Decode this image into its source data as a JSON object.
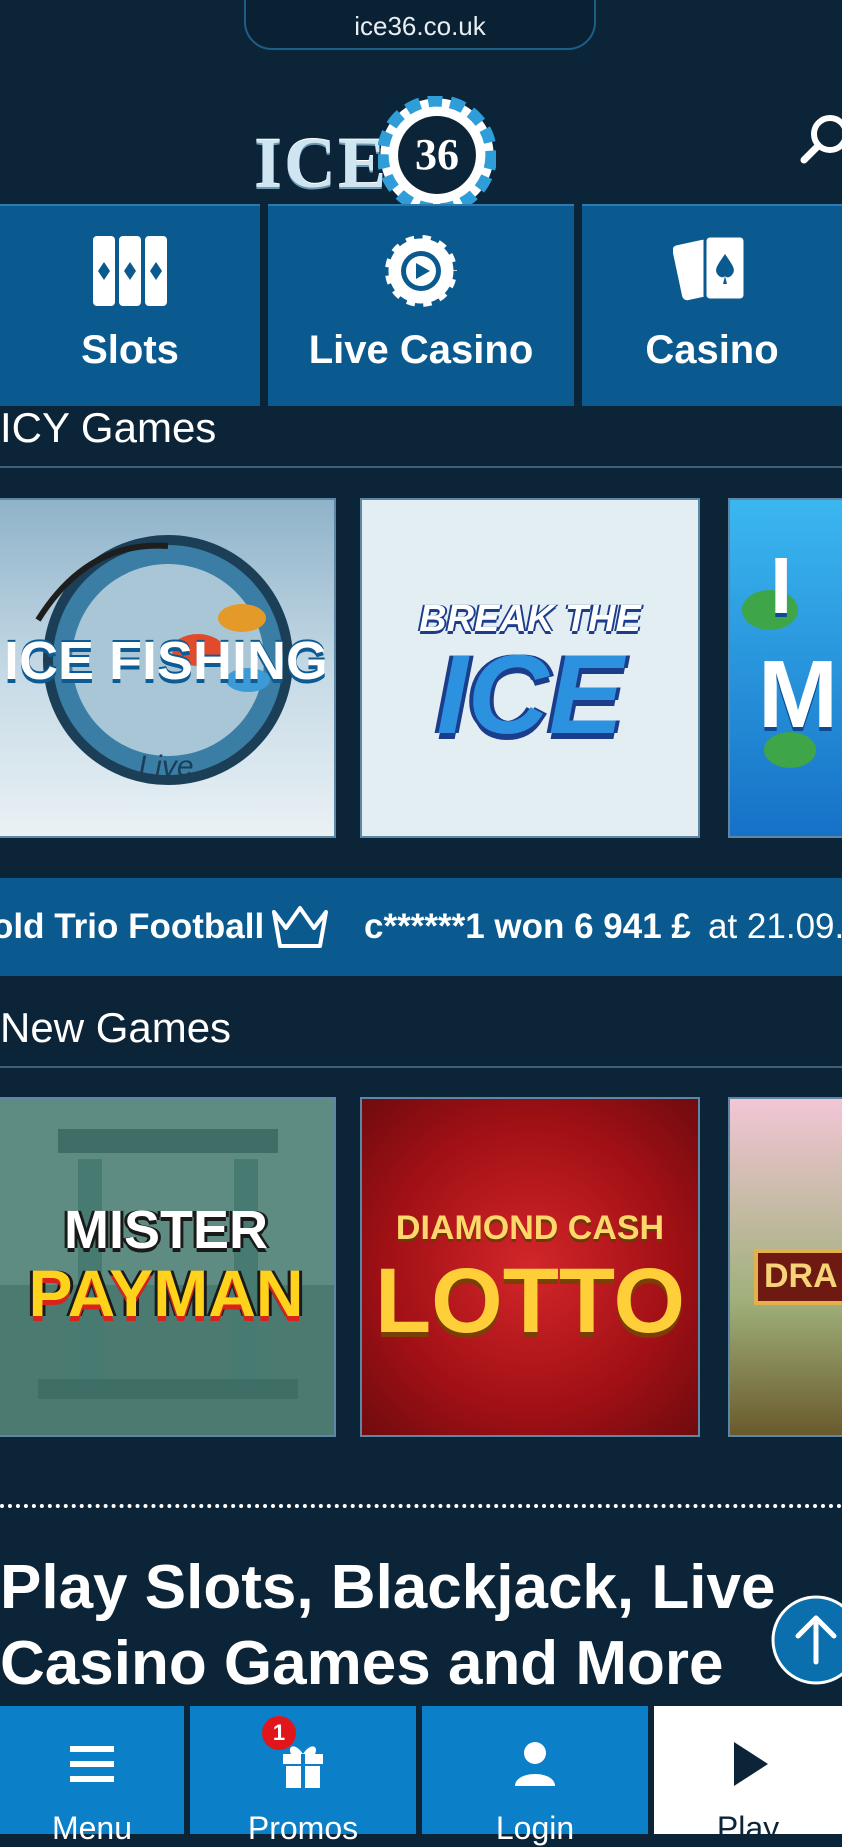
{
  "browser": {
    "url": "ice36.co.uk"
  },
  "header": {
    "logo_text": "ICE",
    "logo_chip_number": "36"
  },
  "categories": [
    {
      "label": "Slots"
    },
    {
      "label": "Live Casino"
    },
    {
      "label": "Casino"
    }
  ],
  "sections": [
    {
      "title": "ICY Games",
      "games": [
        {
          "title": "ICE FISHING",
          "subtitle": "Live"
        },
        {
          "title": "ICE",
          "subtitle": "BREAK THE"
        },
        {
          "title": "M",
          "subtitle": "I"
        }
      ]
    },
    {
      "title": "New Games",
      "games": [
        {
          "title": "PAYMAN",
          "subtitle": "MISTER"
        },
        {
          "title": "LOTTO",
          "subtitle": "DIAMOND CASH"
        },
        {
          "title": "DRA",
          "subtitle": ""
        }
      ]
    }
  ],
  "ticker": {
    "game_fragment": "old Trio Football",
    "winner": "c******1 won 6 941 £",
    "suffix": " at 21.09."
  },
  "headline": "Play Slots, Blackjack, Live Casino Games and More",
  "bottom_nav": [
    {
      "label": "Menu",
      "icon": "menu-icon"
    },
    {
      "label": "Promos",
      "icon": "gift-icon",
      "badge": "1"
    },
    {
      "label": "Login",
      "icon": "user-icon"
    },
    {
      "label": "Play",
      "icon": "play-icon"
    }
  ],
  "colors": {
    "background": "#0c2437",
    "tile_blue": "#0a5a8f",
    "nav_blue": "#0b7fc7",
    "badge_red": "#e0161b"
  }
}
